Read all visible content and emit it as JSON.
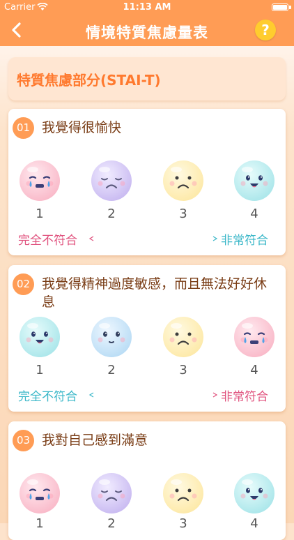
{
  "status_bar": {
    "carrier": "Carrier",
    "time": "11:13 AM"
  },
  "nav": {
    "title": "情境特質焦慮量表",
    "help_label": "?"
  },
  "section": {
    "title": "特質焦慮部分(STAI-T)"
  },
  "colors": {
    "accent": "#ff9c55",
    "pink": "#e0527e",
    "teal": "#3ab7c8",
    "help": "#ffcc2e"
  },
  "questions": [
    {
      "number": "01",
      "text": "我覺得很愉快",
      "faces": [
        "crying-pink-face-icon",
        "sad-purple-face-icon",
        "frown-yellow-face-icon",
        "happy-teal-face-icon"
      ],
      "options": [
        "1",
        "2",
        "3",
        "4"
      ],
      "left_label": "完全不符合",
      "right_label": "非常符合"
    },
    {
      "number": "02",
      "text": "我覺得精神過度敏感，而且無法好好休息",
      "faces": [
        "happy-teal-face-icon",
        "calm-blue-face-icon",
        "frown-yellow-face-icon",
        "crying-pink-face-icon"
      ],
      "options": [
        "1",
        "2",
        "3",
        "4"
      ],
      "left_label": "完全不符合",
      "right_label": "非常符合"
    },
    {
      "number": "03",
      "text": "我對自己感到滿意",
      "faces": [
        "crying-pink-face-icon",
        "sad-purple-face-icon",
        "frown-yellow-face-icon",
        "happy-teal-face-icon"
      ],
      "options": [
        "1",
        "2",
        "3",
        "4"
      ]
    }
  ]
}
